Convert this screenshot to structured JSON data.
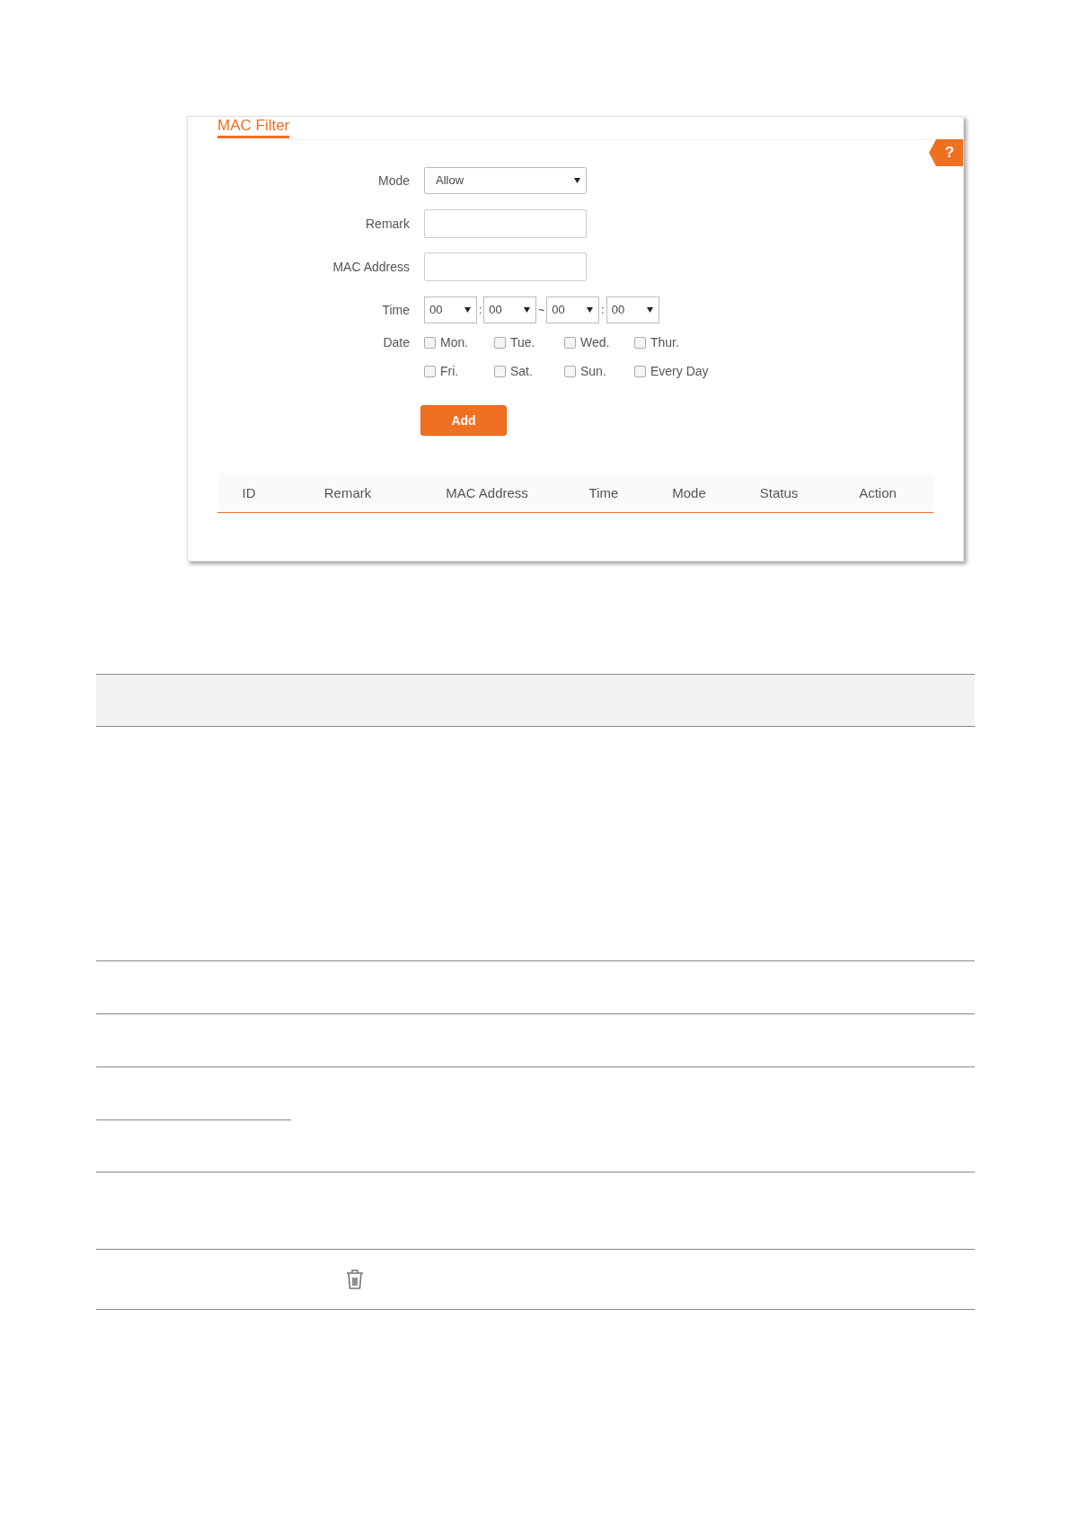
{
  "panel": {
    "title": "MAC Filter",
    "help": "?",
    "mode": {
      "label": "Mode",
      "value": "Allow"
    },
    "remark": {
      "label": "Remark"
    },
    "mac_address": {
      "label": "MAC Address"
    },
    "time": {
      "label": "Time",
      "parts": [
        {
          "kind": "select",
          "value": "00"
        },
        {
          "kind": "separator",
          "text": ":"
        },
        {
          "kind": "select",
          "value": "00"
        },
        {
          "kind": "separator",
          "text": "~"
        },
        {
          "kind": "select",
          "value": "00"
        },
        {
          "kind": "separator",
          "text": ":"
        },
        {
          "kind": "select",
          "value": "00"
        }
      ]
    },
    "date": {
      "label": "Date",
      "days": [
        [
          {
            "label": "Mon.",
            "checked": false
          },
          {
            "label": "Tue.",
            "checked": false
          },
          {
            "label": "Wed.",
            "checked": false
          },
          {
            "label": "Thur.",
            "checked": false
          }
        ],
        [
          {
            "label": "Fri.",
            "checked": false
          },
          {
            "label": "Sat.",
            "checked": false
          },
          {
            "label": "Sun.",
            "checked": false
          },
          {
            "label": "Every Day",
            "checked": false
          }
        ]
      ]
    },
    "add_button": "Add",
    "table": {
      "columns": [
        "ID",
        "Remark",
        "MAC Address",
        "Time",
        "Mode",
        "Status",
        "Action"
      ]
    }
  }
}
